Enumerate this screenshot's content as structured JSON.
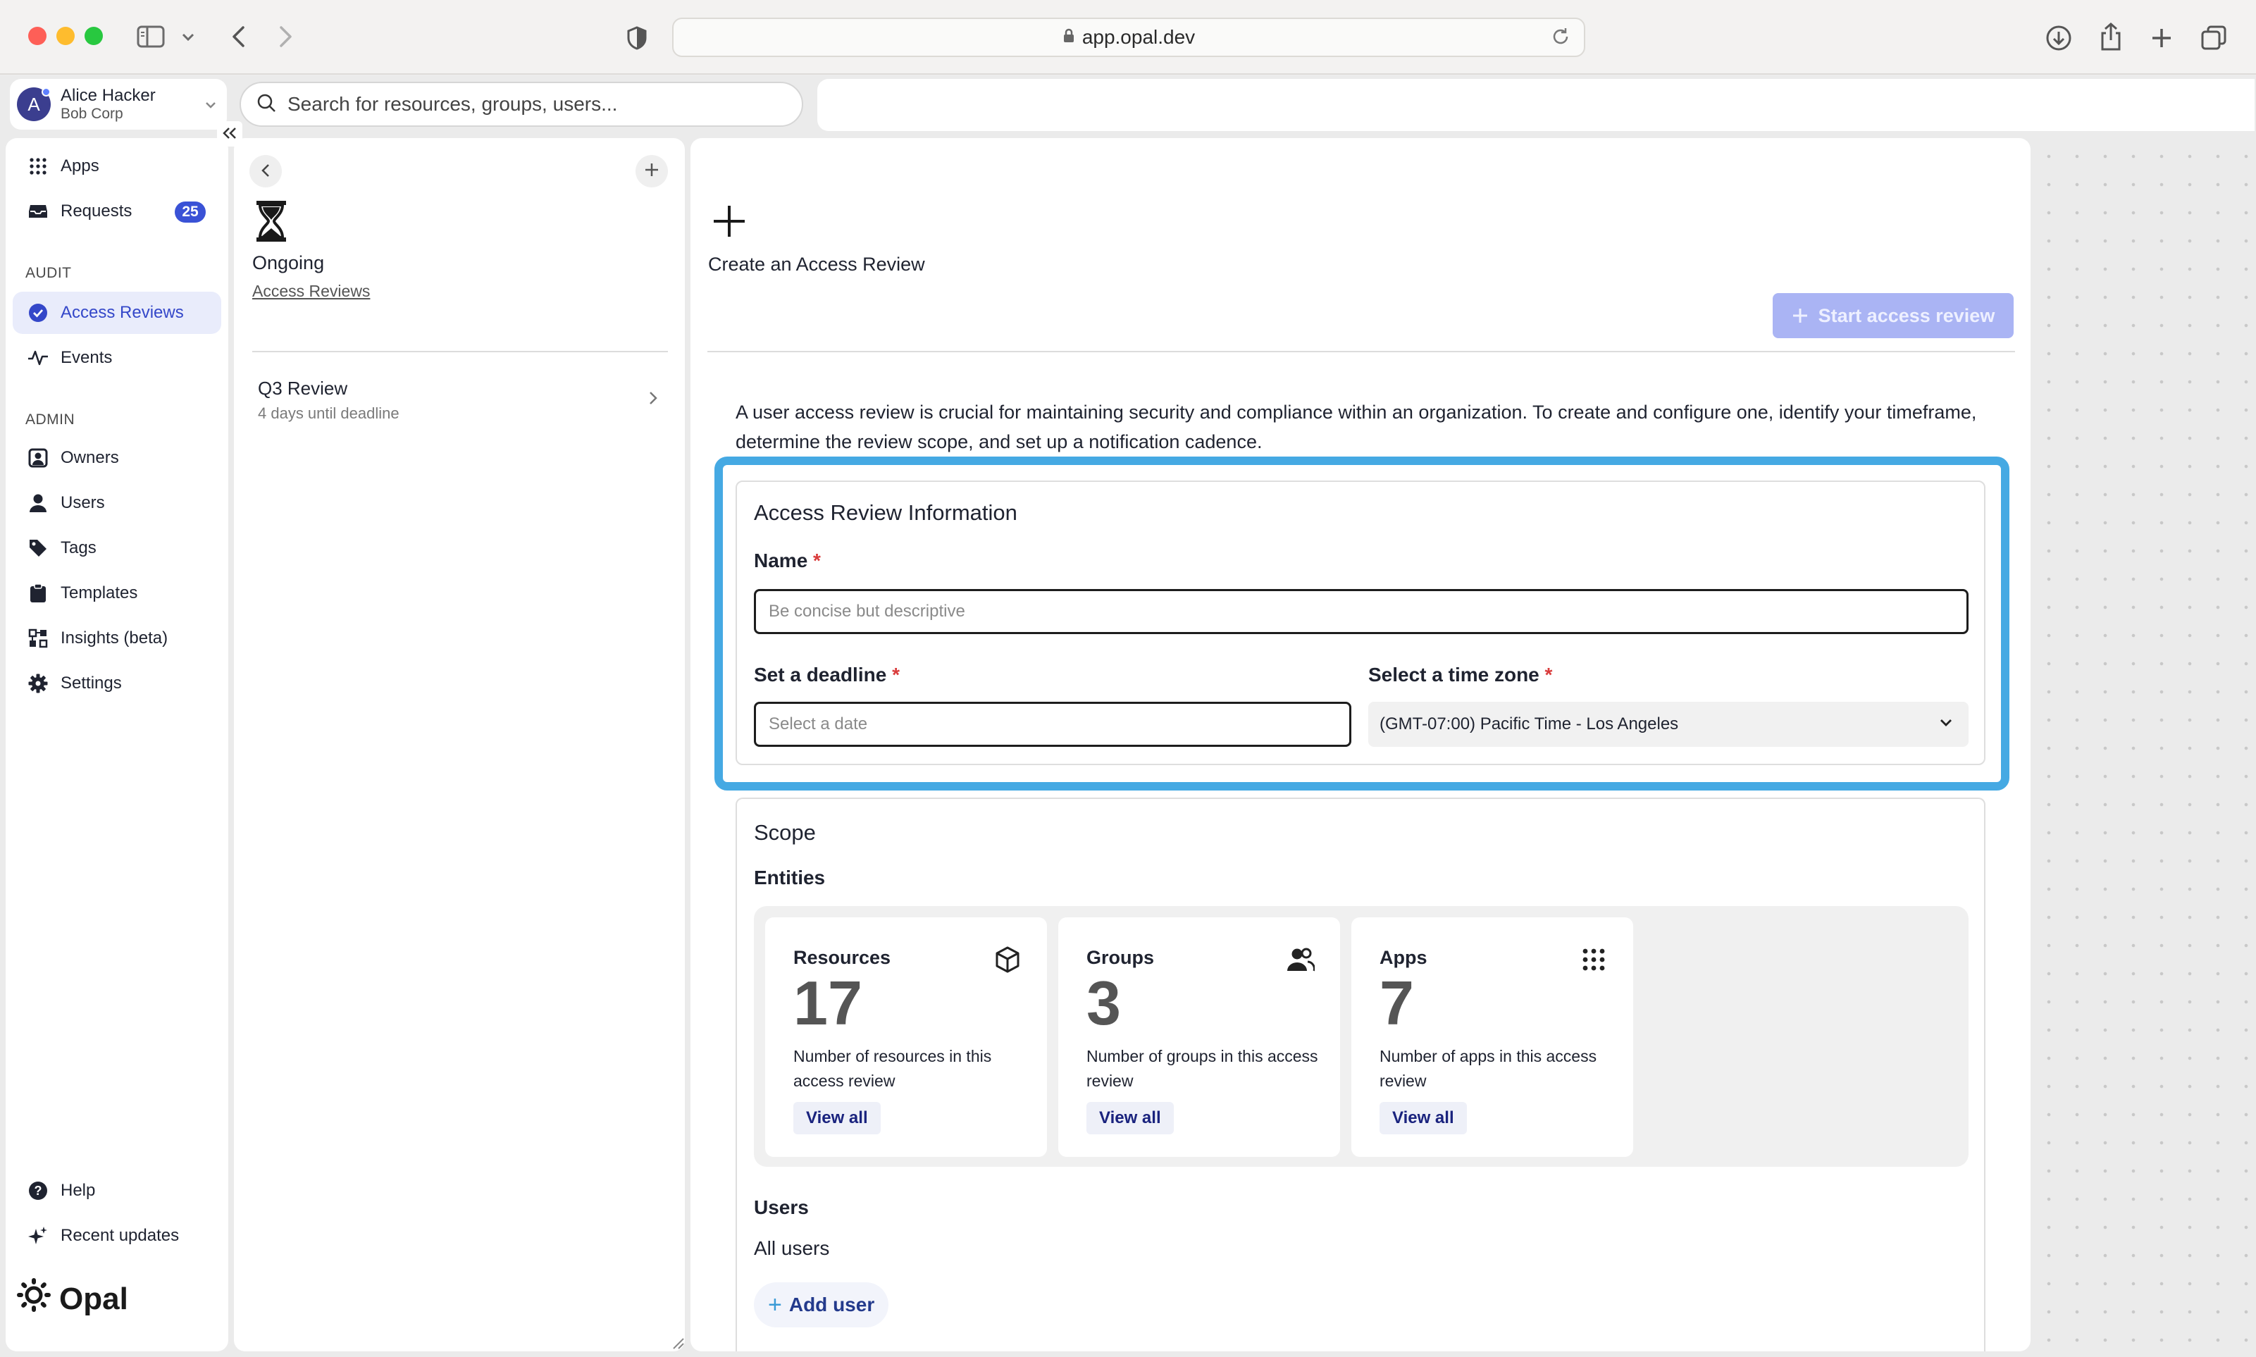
{
  "browser": {
    "url": "app.opal.dev",
    "icons": [
      "sidebar-icon",
      "chevron-down-icon",
      "back-icon",
      "forward-icon",
      "shield-icon",
      "lock-icon",
      "reload-icon",
      "download-icon",
      "share-icon",
      "new-tab-icon",
      "tabs-icon"
    ]
  },
  "user": {
    "initial": "A",
    "name": "Alice Hacker",
    "org": "Bob Corp"
  },
  "search": {
    "placeholder": "Search for resources, groups, users..."
  },
  "nav": {
    "apps": "Apps",
    "requests": "Requests",
    "requests_badge": "25",
    "audit_section": "AUDIT",
    "access_reviews": "Access Reviews",
    "events": "Events",
    "admin_section": "ADMIN",
    "owners": "Owners",
    "users": "Users",
    "tags": "Tags",
    "templates": "Templates",
    "insights": "Insights (beta)",
    "settings": "Settings",
    "help": "Help",
    "recent_updates": "Recent updates",
    "logo_text": "Opal"
  },
  "middle": {
    "title": "Ongoing",
    "breadcrumb": "Access Reviews",
    "reviews": [
      {
        "name": "Q3 Review",
        "deadline": "4 days until deadline"
      }
    ]
  },
  "main": {
    "title": "Create an Access Review",
    "start_button": "Start access review",
    "intro": "A user access review is crucial for maintaining security and compliance within an organization. To create and configure one, identify your timeframe, determine the review scope, and set up a notification cadence.",
    "info": {
      "title": "Access Review Information",
      "name_label": "Name",
      "name_placeholder": "Be concise but descriptive",
      "deadline_label": "Set a deadline",
      "deadline_placeholder": "Select a date",
      "timezone_label": "Select a time zone",
      "timezone_value": "(GMT-07:00) Pacific Time - Los Angeles",
      "required_mark": "*"
    },
    "scope": {
      "title": "Scope",
      "entities_label": "Entities",
      "entities": [
        {
          "name": "Resources",
          "count": "17",
          "description": "Number of resources in this access review",
          "action": "View all",
          "icon": "cube-icon"
        },
        {
          "name": "Groups",
          "count": "3",
          "description": "Number of groups in this access review",
          "action": "View all",
          "icon": "users-icon"
        },
        {
          "name": "Apps",
          "count": "7",
          "description": "Number of apps in this access review",
          "action": "View all",
          "icon": "grid-icon"
        }
      ],
      "users_label": "Users",
      "users_value": "All users",
      "add_user": "Add user"
    }
  },
  "colors": {
    "accent": "#3a52d6",
    "highlight": "#45a9e3",
    "required": "#d93b3b",
    "start_button": "#aab4f4"
  }
}
